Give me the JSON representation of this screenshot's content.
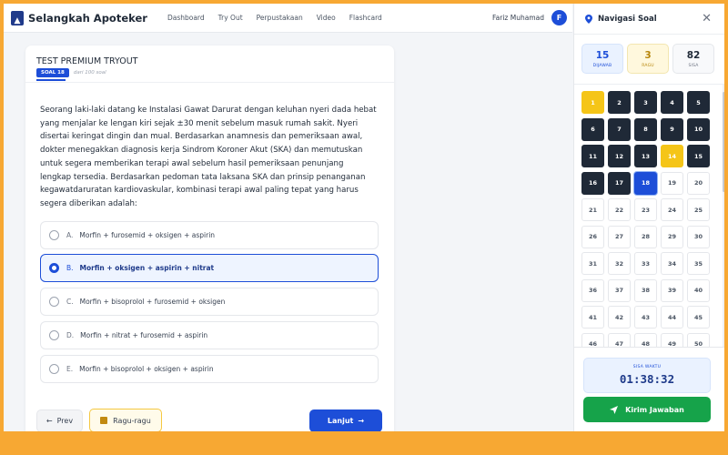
{
  "app": {
    "brand": "Selangkah Apoteker"
  },
  "nav": [
    "Dashboard",
    "Try Out",
    "Perpustakaan",
    "Video",
    "Flashcard"
  ],
  "user": {
    "name": "Fariz Muhamad",
    "initial": "F"
  },
  "exam": {
    "title": "TEST PREMIUM TRYOUT",
    "soal_label": "SOAL 18",
    "soal_of": "dari 100 soal",
    "question": "Seorang laki-laki datang ke Instalasi Gawat Darurat dengan keluhan nyeri dada hebat yang menjalar ke lengan kiri sejak ±30 menit sebelum masuk rumah sakit. Nyeri disertai keringat dingin dan mual. Berdasarkan anamnesis dan pemeriksaan awal, dokter menegakkan diagnosis kerja Sindrom Koroner Akut (SKA) dan memutuskan untuk segera memberikan terapi awal sebelum hasil pemeriksaan penunjang lengkap tersedia. Berdasarkan pedoman tata laksana SKA dan prinsip penanganan kegawatdaruratan kardiovaskular, kombinasi terapi awal paling tepat yang harus segera diberikan adalah:",
    "options": [
      {
        "letter": "A.",
        "text": "Morfin + furosemid + oksigen + aspirin",
        "selected": false
      },
      {
        "letter": "B.",
        "text": "Morfin + oksigen + aspirin + nitrat",
        "selected": true
      },
      {
        "letter": "C.",
        "text": "Morfin + bisoprolol + furosemid + oksigen",
        "selected": false
      },
      {
        "letter": "D.",
        "text": "Morfin + nitrat + furosemid + aspirin",
        "selected": false
      },
      {
        "letter": "E.",
        "text": "Morfin + bisoprolol + oksigen + aspirin",
        "selected": false
      }
    ],
    "buttons": {
      "prev": "Prev",
      "ragu": "Ragu-ragu",
      "next": "Lanjut"
    }
  },
  "sidebar": {
    "title": "Navigasi Soal",
    "stats": [
      {
        "value": "15",
        "label": "DIJAWAB"
      },
      {
        "value": "3",
        "label": "RAGU"
      },
      {
        "value": "82",
        "label": "SISA"
      }
    ],
    "visible_cells": 50,
    "answered": [
      2,
      3,
      4,
      5,
      6,
      7,
      8,
      9,
      10,
      11,
      12,
      13,
      15,
      16,
      17
    ],
    "doubt": [
      1,
      14
    ],
    "current": 18,
    "timer_label": "SISA WAKTU",
    "timer": "01:38:32",
    "submit": "Kirim Jawaban"
  },
  "colors": {
    "primary": "#1d4ed8",
    "doubt": "#f5c518",
    "answered": "#1f2937",
    "submit": "#16a34a",
    "frame": "#f7a833"
  }
}
